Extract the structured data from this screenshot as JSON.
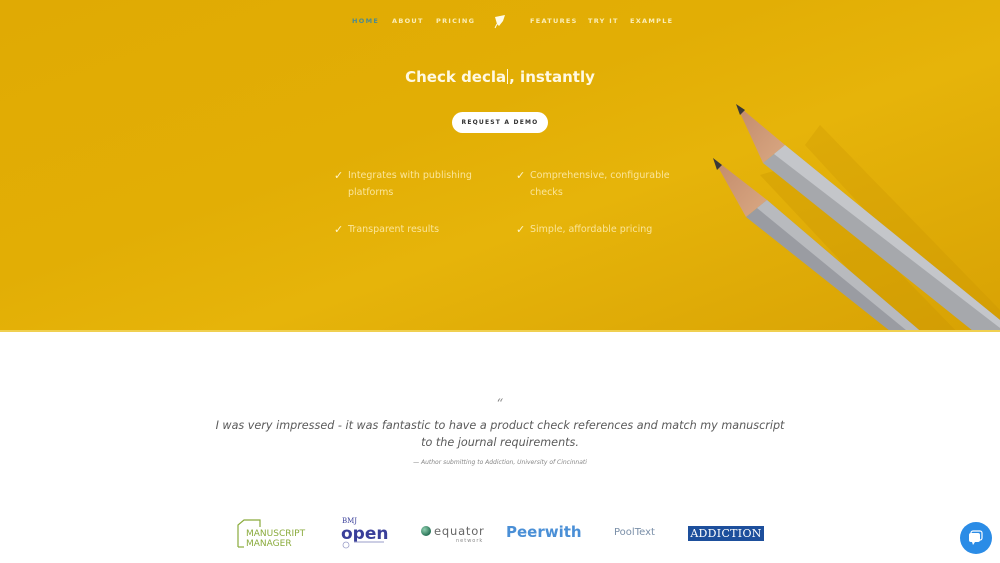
{
  "nav": {
    "left_items": [
      {
        "label": "HOME",
        "active": true
      },
      {
        "label": "ABOUT",
        "active": false
      },
      {
        "label": "PRICING",
        "active": false
      }
    ],
    "right_items": [
      {
        "label": "FEATURES",
        "active": false
      },
      {
        "label": "TRY IT",
        "active": false
      },
      {
        "label": "EXAMPLE",
        "active": false
      }
    ],
    "logo_icon": "quill-logo-icon"
  },
  "hero": {
    "headline_prefix": "Check ",
    "headline_typed": "decla",
    "headline_suffix": ", instantly",
    "cta_label": "REQUEST A DEMO",
    "features": [
      {
        "label": "Integrates with publishing platforms",
        "line1": "Integrates with publishing",
        "line2": "platforms"
      },
      {
        "label": "Comprehensive, configurable checks",
        "line1": "Comprehensive, configurable",
        "line2": "checks"
      },
      {
        "label": "Transparent results",
        "line1": "Transparent results",
        "line2": ""
      },
      {
        "label": "Simple, affordable pricing",
        "line1": "Simple, affordable pricing",
        "line2": ""
      }
    ],
    "check_icon": "checkmark-icon",
    "bg_color": "#e2ae05"
  },
  "testimonial": {
    "quote_mark": "“",
    "line1": "I was very impressed - it was fantastic to have a product check references and match my manuscript",
    "line2": "to the journal requirements.",
    "author": "— Author submitting to Addiction, University of Cincinnati"
  },
  "partners": {
    "manuscript_manager": {
      "line1": "MANUSCRIPT",
      "line2": "MANAGER",
      "color": "#8aab3c"
    },
    "bmj_open": {
      "top": "BMJ",
      "main": "open",
      "color": "#3a3f9a"
    },
    "equator": {
      "main": "equator",
      "sub": "network",
      "color": "#666"
    },
    "peerwith": {
      "main": "Peerwith",
      "color": "#4a8fd6"
    },
    "pooltext": {
      "main": "PoolText",
      "color": "#7a8fa8"
    },
    "addiction": {
      "main": "ADDICTION",
      "bg": "#1d4f9c"
    }
  },
  "chat": {
    "icon": "chat-bubble-icon",
    "color": "#2b8ce6"
  }
}
